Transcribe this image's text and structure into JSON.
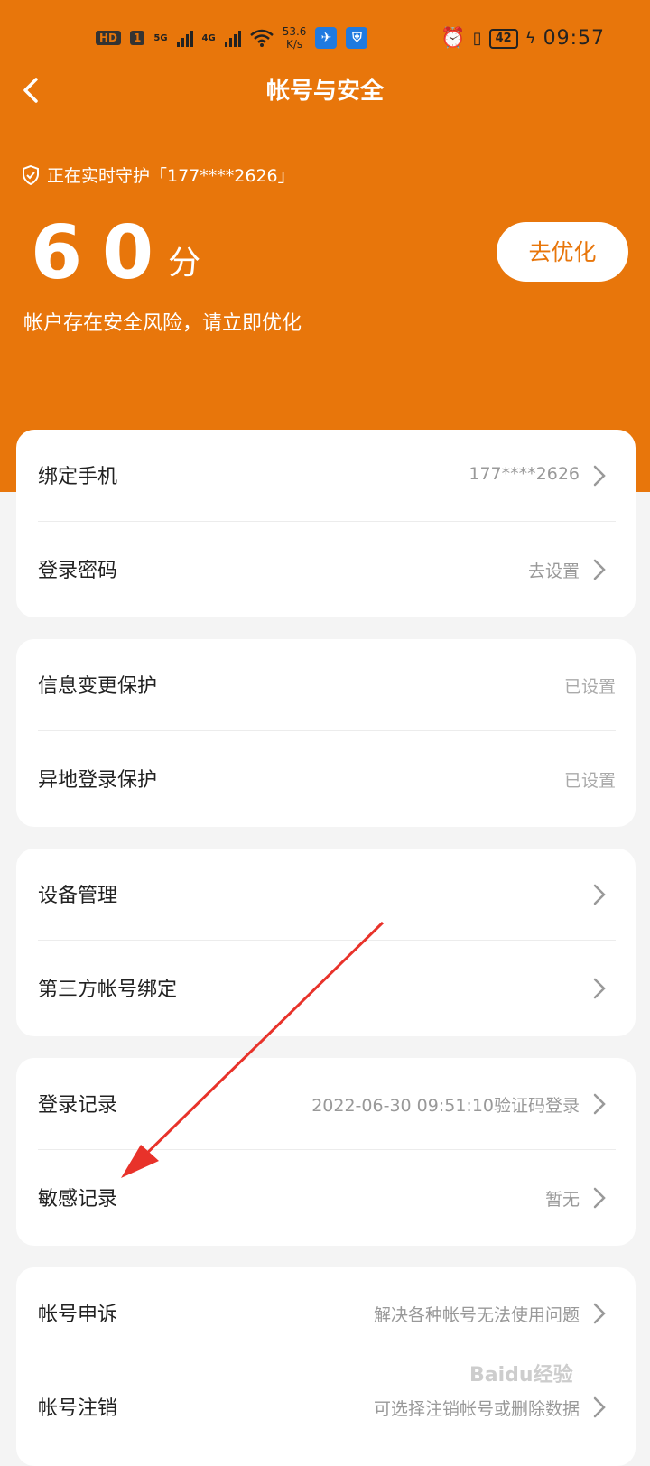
{
  "status_bar": {
    "hd_label": "HD",
    "sim_label": "1",
    "net1": "5G",
    "net2": "4G",
    "speed_value": "53.6",
    "speed_unit": "K/s",
    "battery": "42",
    "time": "09:57"
  },
  "header": {
    "title": "帐号与安全"
  },
  "hero": {
    "guard_text": "正在实时守护「177****2626」",
    "score_value": "60",
    "score_unit": "分",
    "risk_text": "帐户存在安全风险，请立即优化",
    "optimize_label": "去优化"
  },
  "cards": [
    {
      "rows": [
        {
          "label": "绑定手机",
          "value": "177****2626",
          "arrow": true
        },
        {
          "label": "登录密码",
          "value": "去设置",
          "arrow": true
        }
      ]
    },
    {
      "rows": [
        {
          "label": "信息变更保护",
          "value": "已设置",
          "arrow": false
        },
        {
          "label": "异地登录保护",
          "value": "已设置",
          "arrow": false
        }
      ]
    },
    {
      "rows": [
        {
          "label": "设备管理",
          "value": "",
          "arrow": true
        },
        {
          "label": "第三方帐号绑定",
          "value": "",
          "arrow": true
        }
      ]
    },
    {
      "rows": [
        {
          "label": "登录记录",
          "value": "2022-06-30 09:51:10验证码登录",
          "arrow": true
        },
        {
          "label": "敏感记录",
          "value": "暂无",
          "arrow": true
        }
      ]
    },
    {
      "rows": [
        {
          "label": "帐号申诉",
          "value": "解决各种帐号无法使用问题",
          "arrow": true
        },
        {
          "label": "帐号注销",
          "value": "可选择注销帐号或删除数据",
          "arrow": true
        }
      ]
    }
  ],
  "watermark": "Baidu经验",
  "colors": {
    "brand_orange": "#e8760b",
    "annotation_arrow": "#e8322a"
  }
}
